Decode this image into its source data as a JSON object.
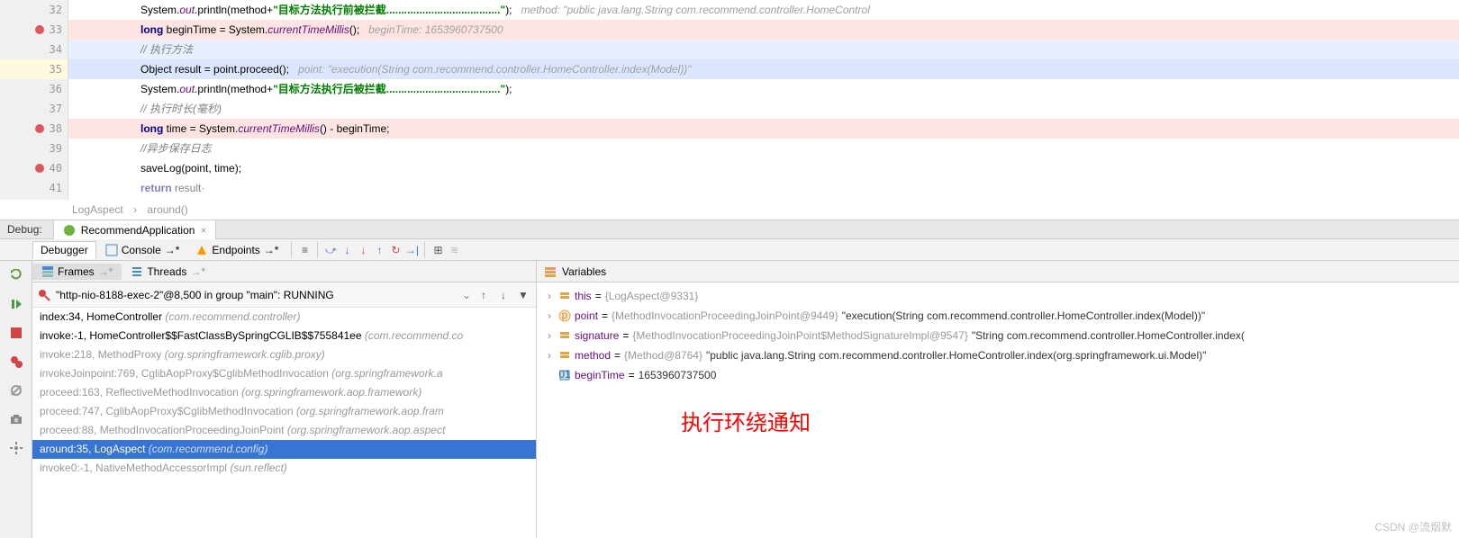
{
  "editor": {
    "lines": [
      {
        "n": 32,
        "bp": false,
        "bg": "",
        "html": "System.<span class='fld'>out</span>.println(method+<span class='str'>\"目标方法执行前被拦截<span class='dots'>......................................</span>\"</span>);&nbsp;&nbsp;&nbsp;<span class='hint'>method: \"public java.lang.String com.recommend.controller.HomeControl</span>"
      },
      {
        "n": 33,
        "bp": true,
        "bg": "line-33-bg",
        "html": "<span class='kw'>long</span> beginTime = System.<span class='fld'>currentTimeMillis</span>();&nbsp;&nbsp;&nbsp;<span class='hint'>beginTime: 1653960737500</span>"
      },
      {
        "n": 34,
        "bp": false,
        "bg": "line-34-bg",
        "html": "<span class='cmt'>// 执行方法</span>"
      },
      {
        "n": 35,
        "bp": false,
        "bg": "line-35-bg",
        "html": "Object result = point.proceed();&nbsp;&nbsp;&nbsp;<span class='hint'>point: \"execution(String com.recommend.controller.HomeController.index(Model))\"</span>"
      },
      {
        "n": 36,
        "bp": false,
        "bg": "",
        "html": "System.<span class='fld'>out</span>.println(method+<span class='str'>\"目标方法执行后被拦截<span class='dots'>......................................</span>\"</span>);"
      },
      {
        "n": 37,
        "bp": false,
        "bg": "",
        "html": "<span class='cmt'>// 执行时长(毫秒)</span>"
      },
      {
        "n": 38,
        "bp": true,
        "bg": "line-38-bg",
        "html": "<span class='kw'>long</span> time = System.<span class='fld'>currentTimeMillis</span>() - beginTime;"
      },
      {
        "n": 39,
        "bp": false,
        "bg": "",
        "html": "<span class='cmt'>//异步保存日志</span>"
      },
      {
        "n": 40,
        "bp": true,
        "bg": "",
        "html": "saveLog(point, time);"
      },
      {
        "n": 41,
        "bp": false,
        "bg": "",
        "html": "<span class='kw' style='opacity:.5'>return</span><span style='opacity:.5'> result&middot;</span>"
      }
    ]
  },
  "breadcrumb": {
    "a": "LogAspect",
    "b": "around()"
  },
  "debugTab": "RecommendApplication",
  "debugLabel": "Debug:",
  "toolTabs": {
    "debugger": "Debugger",
    "console": "Console",
    "endpoints": "Endpoints"
  },
  "panels": {
    "frames": "Frames",
    "threads": "Threads",
    "variables": "Variables"
  },
  "thread": "\"http-nio-8188-exec-2\"@8,500 in group \"main\": RUNNING",
  "frames": [
    {
      "txt": "index:34, HomeController",
      "pkg": "(com.recommend.controller)",
      "dim": false,
      "sel": false,
      "lib": false
    },
    {
      "txt": "invoke:-1, HomeController$$FastClassBySpringCGLIB$$755841ee",
      "pkg": "(com.recommend.co",
      "dim": false,
      "sel": false,
      "lib": false
    },
    {
      "txt": "invoke:218, MethodProxy",
      "pkg": "(org.springframework.cglib.proxy)",
      "dim": true,
      "sel": false,
      "lib": true
    },
    {
      "txt": "invokeJoinpoint:769, CglibAopProxy$CglibMethodInvocation",
      "pkg": "(org.springframework.a",
      "dim": true,
      "sel": false,
      "lib": true
    },
    {
      "txt": "proceed:163, ReflectiveMethodInvocation",
      "pkg": "(org.springframework.aop.framework)",
      "dim": true,
      "sel": false,
      "lib": true
    },
    {
      "txt": "proceed:747, CglibAopProxy$CglibMethodInvocation",
      "pkg": "(org.springframework.aop.fram",
      "dim": true,
      "sel": false,
      "lib": true
    },
    {
      "txt": "proceed:88, MethodInvocationProceedingJoinPoint",
      "pkg": "(org.springframework.aop.aspect",
      "dim": true,
      "sel": false,
      "lib": true
    },
    {
      "txt": "around:35, LogAspect",
      "pkg": "(com.recommend.config)",
      "dim": false,
      "sel": true,
      "lib": false
    },
    {
      "txt": "invoke0:-1, NativeMethodAccessorImpl",
      "pkg": "(sun.reflect)",
      "dim": true,
      "sel": false,
      "lib": true
    }
  ],
  "vars": [
    {
      "exp": "›",
      "icon": "obj",
      "name": "this",
      "eq": " = ",
      "type": "{LogAspect@9331}",
      "val": ""
    },
    {
      "exp": "›",
      "icon": "param",
      "name": "point",
      "eq": " = ",
      "type": "{MethodInvocationProceedingJoinPoint@9449}",
      "val": " \"execution(String com.recommend.controller.HomeController.index(Model))\""
    },
    {
      "exp": "›",
      "icon": "obj",
      "name": "signature",
      "eq": " = ",
      "type": "{MethodInvocationProceedingJoinPoint$MethodSignatureImpl@9547}",
      "val": " \"String com.recommend.controller.HomeController.index("
    },
    {
      "exp": "›",
      "icon": "obj",
      "name": "method",
      "eq": " = ",
      "type": "{Method@8764}",
      "val": " \"public java.lang.String com.recommend.controller.HomeController.index(org.springframework.ui.Model)\""
    },
    {
      "exp": "",
      "icon": "prim",
      "name": "beginTime",
      "eq": " = ",
      "type": "",
      "val": "1653960737500"
    }
  ],
  "annotation": "执行环绕通知",
  "watermark": "CSDN @流烟默"
}
